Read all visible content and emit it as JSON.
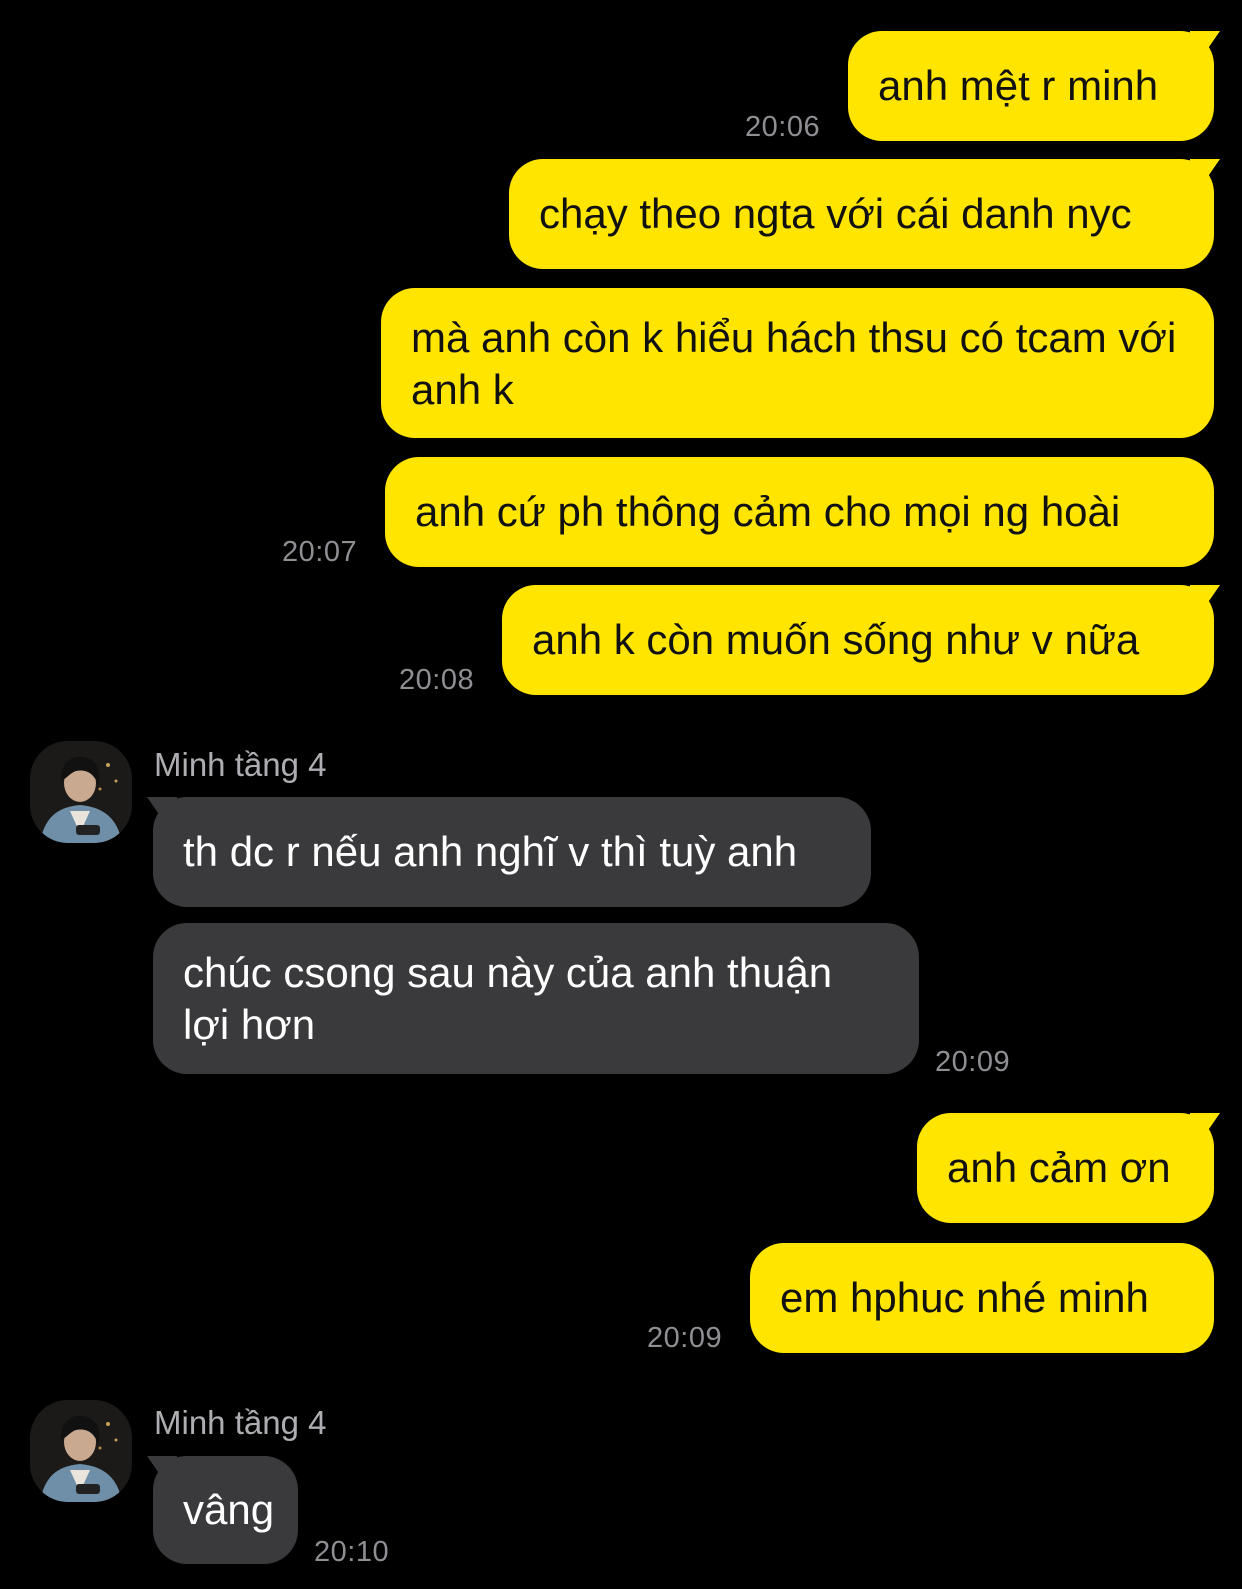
{
  "contact": {
    "name": "Minh tầng 4"
  },
  "messages": [
    {
      "text": "anh mệt r minh"
    },
    {
      "text": "chạy theo ngta với cái danh nyc"
    },
    {
      "text": "mà anh còn k hiểu hách thsu có tcam với anh k"
    },
    {
      "text": "anh cứ ph thông cảm cho mọi ng hoài"
    },
    {
      "text": "anh k còn muốn sống như v nữa"
    },
    {
      "text": "th dc r nếu anh nghĩ v thì tuỳ anh"
    },
    {
      "text": "chúc csong sau này của anh thuận lợi hơn"
    },
    {
      "text": "anh cảm ơn"
    },
    {
      "text": "em hphuc nhé minh"
    },
    {
      "text": "vâng"
    }
  ],
  "timestamps": [
    "20:06",
    "20:07",
    "20:08",
    "20:09",
    "20:09",
    "20:10"
  ],
  "colors": {
    "background": "#000000",
    "outgoing_bubble": "#FFE500",
    "incoming_bubble": "#3A3A3C",
    "timestamp": "#8E8E93"
  }
}
